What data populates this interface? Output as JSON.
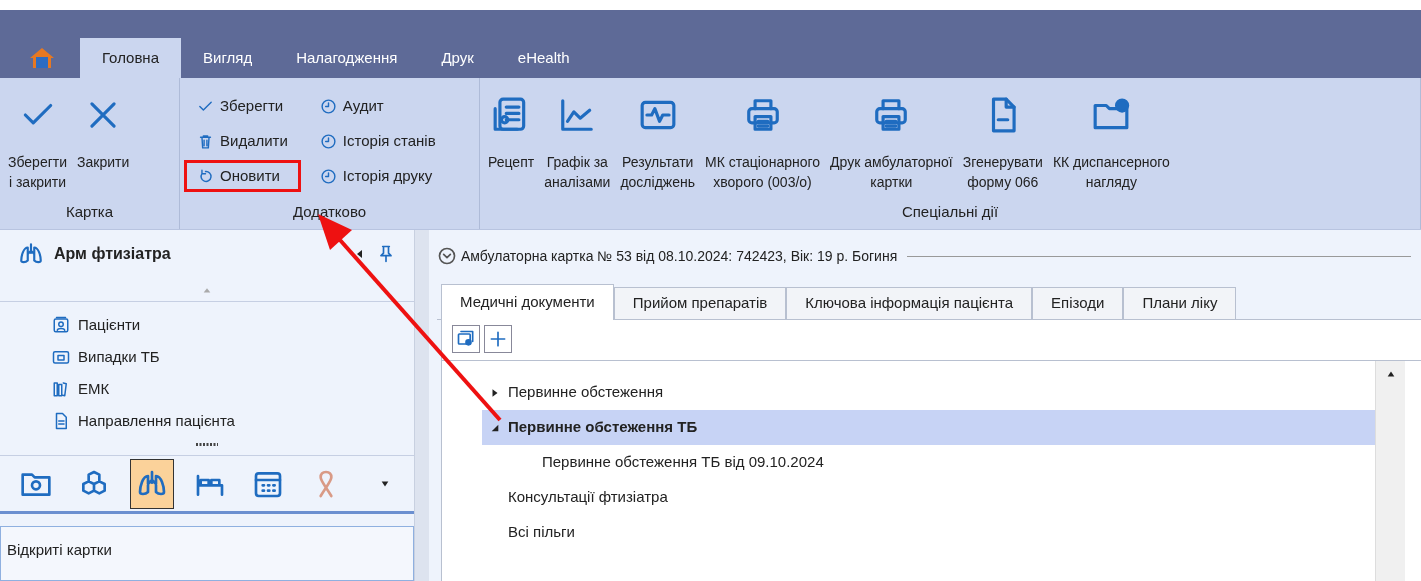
{
  "ribbon_tabs": [
    {
      "label": "Головна",
      "selected": true
    },
    {
      "label": "Вигляд",
      "selected": false
    },
    {
      "label": "Налагодження",
      "selected": false
    },
    {
      "label": "Друк",
      "selected": false
    },
    {
      "label": "eHealth",
      "selected": false
    }
  ],
  "ribbon_groups": [
    {
      "title": "Картка",
      "kind": "large",
      "buttons": [
        {
          "label": "Зберегти\nі закрити",
          "kind": "check"
        },
        {
          "label": "Закрити",
          "kind": "cross"
        }
      ]
    },
    {
      "title": "Додатково",
      "kind": "small",
      "buttons": [
        {
          "label": "Зберегти",
          "kind": "check",
          "highlighted": false
        },
        {
          "label": "Видалити",
          "kind": "trash",
          "highlighted": false
        },
        {
          "label": "Оновити",
          "kind": "refresh",
          "highlighted": true
        },
        {
          "label": "Аудит",
          "kind": "clock",
          "highlighted": false
        },
        {
          "label": "Історія станів",
          "kind": "clock",
          "highlighted": false
        },
        {
          "label": "Історія друку",
          "kind": "clock",
          "highlighted": false
        }
      ]
    },
    {
      "title": "Спеціальні дії",
      "kind": "large",
      "buttons": [
        {
          "label": "Рецепт",
          "kind": "prescription"
        },
        {
          "label": "Графік за\nаналізами",
          "kind": "chart"
        },
        {
          "label": "Результати\nдосліджень",
          "kind": "pulse"
        },
        {
          "label": "МК стаціонарного\nхворого (003/о)",
          "kind": "printer"
        },
        {
          "label": "Друк амбулаторної\nкартки",
          "kind": "printer"
        },
        {
          "label": "Згенерувати\nформу 066",
          "kind": "file"
        },
        {
          "label": "КК диспансерного\nнагляду",
          "kind": "folder-plus"
        }
      ]
    }
  ],
  "side_panel": {
    "title": "Арм фтизіатра",
    "items": [
      {
        "label": "Пацієнти",
        "kind": "patient"
      },
      {
        "label": "Випадки ТБ",
        "kind": "cases"
      },
      {
        "label": "ЕМК",
        "kind": "books"
      },
      {
        "label": "Направлення пацієнта",
        "kind": "document"
      }
    ],
    "modules": [
      {
        "kind": "folder",
        "selected": false
      },
      {
        "kind": "boxes",
        "selected": false
      },
      {
        "kind": "lungs",
        "selected": true
      },
      {
        "kind": "bed",
        "selected": false
      },
      {
        "kind": "calendar",
        "selected": false
      },
      {
        "kind": "ribbon",
        "selected": false
      }
    ],
    "open_cards_title": "Відкриті картки"
  },
  "card": {
    "title": "Амбулаторна картка № 53 від 08.10.2024: 742423, Вік: 19 р. Богиня",
    "tabs": [
      {
        "label": "Медичні документи",
        "selected": true
      },
      {
        "label": "Прийом препаратів",
        "selected": false
      },
      {
        "label": "Ключова інформація пацієнта",
        "selected": false
      },
      {
        "label": "Епізоди",
        "selected": false
      },
      {
        "label": "Плани ліку",
        "selected": false
      }
    ],
    "tree": [
      {
        "label": "Первинне обстеження",
        "expanded": false,
        "selected": false
      },
      {
        "label": "Первинне обстеження ТБ",
        "expanded": true,
        "selected": true,
        "children": [
          {
            "label": "Первинне обстеження ТБ від 09.10.2024",
            "selected": false
          }
        ]
      },
      {
        "label": "Консультації фтизіатра",
        "selected": false
      },
      {
        "label": "Всі пільги",
        "selected": false
      }
    ]
  }
}
